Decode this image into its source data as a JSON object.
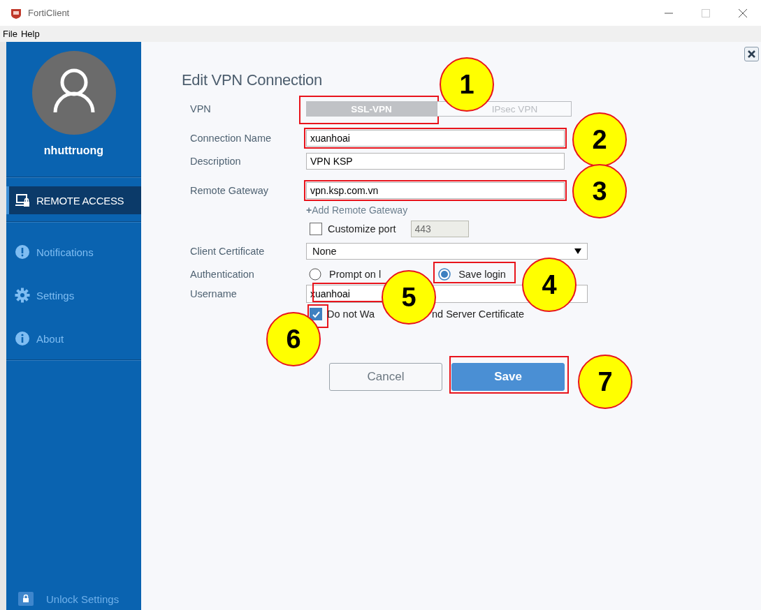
{
  "window": {
    "title": "FortiClient"
  },
  "menu": [
    "File",
    "Help"
  ],
  "sidebar": {
    "username": "nhuttruong",
    "items": [
      {
        "label": "REMOTE ACCESS",
        "selected": true
      },
      {
        "label": "Notifications",
        "selected": false
      },
      {
        "label": "Settings",
        "selected": false
      },
      {
        "label": "About",
        "selected": false
      }
    ],
    "footer": "Unlock Settings"
  },
  "form": {
    "title": "Edit VPN Connection",
    "vpn_label": "VPN",
    "vpn_types": [
      {
        "label": "SSL-VPN",
        "selected": true
      },
      {
        "label": "IPsec VPN",
        "selected": false
      }
    ],
    "connection_name": {
      "label": "Connection Name",
      "value": "xuanhoai"
    },
    "description": {
      "label": "Description",
      "value": "VPN KSP"
    },
    "remote_gateway": {
      "label": "Remote Gateway",
      "value": "vpn.ksp.com.vn"
    },
    "add_gateway": "**+**Add Remote Gateway",
    "customize_port": {
      "label": "Customize port",
      "checked": false,
      "value": "443",
      "disabled": true
    },
    "client_certificate": {
      "label": "Client Certificate",
      "value": "None"
    },
    "authentication": {
      "label": "Authentication",
      "options": [
        {
          "label": "Prompt on l",
          "selected": false
        },
        {
          "label": "Save login",
          "selected": true
        }
      ]
    },
    "username": {
      "label": "Username",
      "value": "xuanhoai"
    },
    "warn_certificate": {
      "label_parts": [
        "Do not Wa",
        "nd Server Certificate"
      ],
      "checked": true
    },
    "buttons": [
      "Cancel",
      "Save"
    ]
  },
  "annotations": [
    {
      "number": "1"
    },
    {
      "number": "2"
    },
    {
      "number": "3"
    },
    {
      "number": "4"
    },
    {
      "number": "5"
    },
    {
      "number": "6"
    },
    {
      "number": "7"
    }
  ]
}
